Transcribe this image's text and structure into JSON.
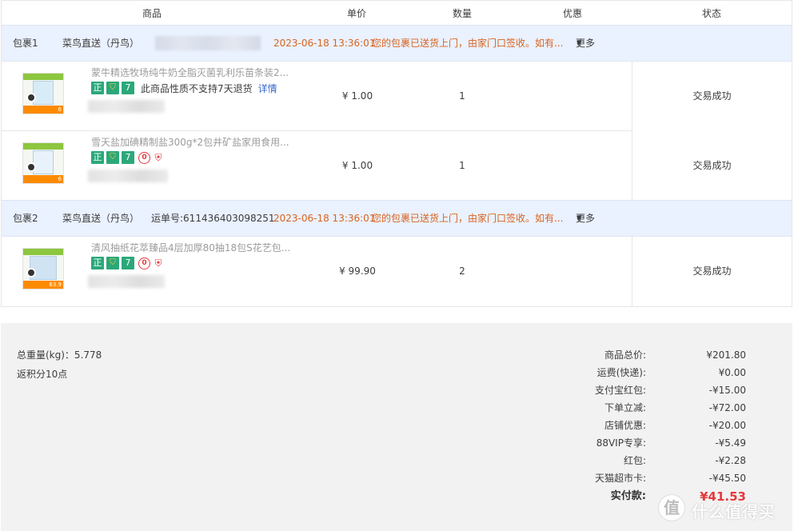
{
  "table_header": {
    "product": "商品",
    "unit_price": "单价",
    "quantity": "数量",
    "discount": "优惠",
    "status": "状态"
  },
  "packages": [
    {
      "name": "包裹1",
      "carrier": "菜鸟直送（丹鸟）",
      "tracking": "",
      "time": "2023-06-18 13:36:01",
      "message": "您的包裹已送货上门，由家门口签收。如有...",
      "more": "更多",
      "status": "交易成功",
      "items": [
        {
          "title": "蒙牛精选牧场纯牛奶全脂灭菌乳利乐苗条装2...",
          "no_return_text": "此商品性质不支持7天退货",
          "detail_link": "详情",
          "badges": [
            "正",
            "gold-icon",
            "7"
          ],
          "thumb_price": "6",
          "price": "¥ 1.00",
          "quantity": "1"
        },
        {
          "title": "雪天盐加碘精制盐300g*2包井矿盐家用食用...",
          "badges": [
            "正",
            "gold-icon",
            "7",
            "0",
            "shield-icon"
          ],
          "thumb_price": "6",
          "price": "¥ 1.00",
          "quantity": "1"
        }
      ]
    },
    {
      "name": "包裹2",
      "carrier": "菜鸟直送（丹鸟）",
      "tracking": "运单号:611436403098251",
      "time": "2023-06-18 13:36:01",
      "message": "您的包裹已送货上门，由家门口签收。如有...",
      "more": "更多",
      "status": "交易成功",
      "items": [
        {
          "title": "清风抽纸花萃臻品4层加厚80抽18包S花艺包...",
          "badges": [
            "正",
            "gold-icon",
            "7",
            "0",
            "shield-icon"
          ],
          "thumb_price": "63.9",
          "price": "¥ 99.90",
          "quantity": "2"
        }
      ]
    }
  ],
  "summary": {
    "weight": "总重量(kg)：5.778",
    "points": "返积分10点",
    "rows": [
      {
        "label": "商品总价:",
        "value": "¥201.80"
      },
      {
        "label": "运费(快递):",
        "value": "¥0.00"
      },
      {
        "label": "支付宝红包:",
        "value": "-¥15.00"
      },
      {
        "label": "下单立减:",
        "value": "-¥72.00"
      },
      {
        "label": "店铺优惠:",
        "value": "-¥20.00"
      },
      {
        "label": "88VIP专享:",
        "value": "-¥5.49"
      },
      {
        "label": "红包:",
        "value": "-¥2.28"
      },
      {
        "label": "天猫超市卡:",
        "value": "-¥45.50"
      }
    ],
    "total_label": "实付款:",
    "total_value": "¥41.53"
  },
  "watermark": {
    "logo": "值",
    "text": "什么值得买"
  },
  "colors": {
    "package_header_bg": "#eaf1ff",
    "orange_text": "#d9641f",
    "link_blue": "#3366cc",
    "total_red": "#e4393c",
    "badge_green": "#2ba87a",
    "summary_bg": "#f2f2f2"
  }
}
